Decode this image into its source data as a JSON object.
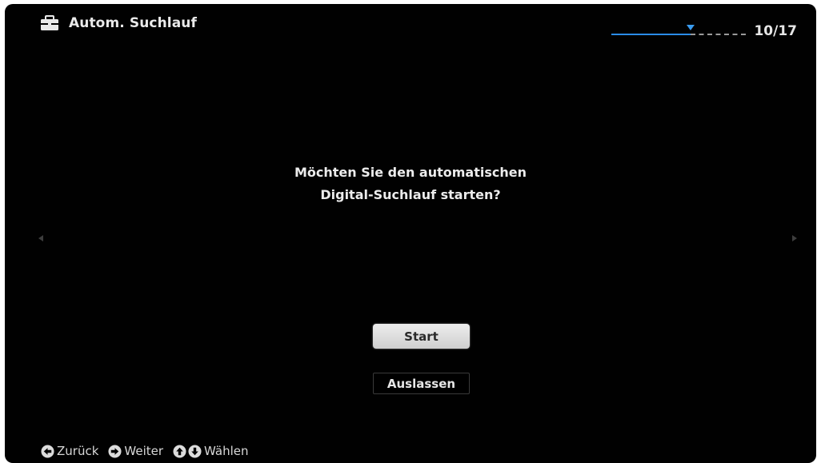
{
  "header": {
    "icon": "toolbox-icon",
    "title": "Autom. Suchlauf",
    "step_label": "10/17",
    "progress": {
      "current": 10,
      "total": 17,
      "fill_color": "#2a8ce8"
    }
  },
  "question": {
    "line1": "Möchten Sie den automatischen",
    "line2": "Digital-Suchlauf starten?"
  },
  "buttons": {
    "start_label": "Start",
    "skip_label": "Auslassen"
  },
  "footer": {
    "back": {
      "icon": "arrow-left-circle-icon",
      "label": "Zurück"
    },
    "next": {
      "icon": "arrow-right-circle-icon",
      "label": "Weiter"
    },
    "select": {
      "icons": [
        "arrow-up-circle-icon",
        "arrow-down-circle-icon"
      ],
      "label": "Wählen"
    }
  },
  "colors": {
    "background": "#010101",
    "text": "#e9e9e9",
    "accent": "#2a8ce8",
    "selected_button": "#dcdcdc"
  }
}
